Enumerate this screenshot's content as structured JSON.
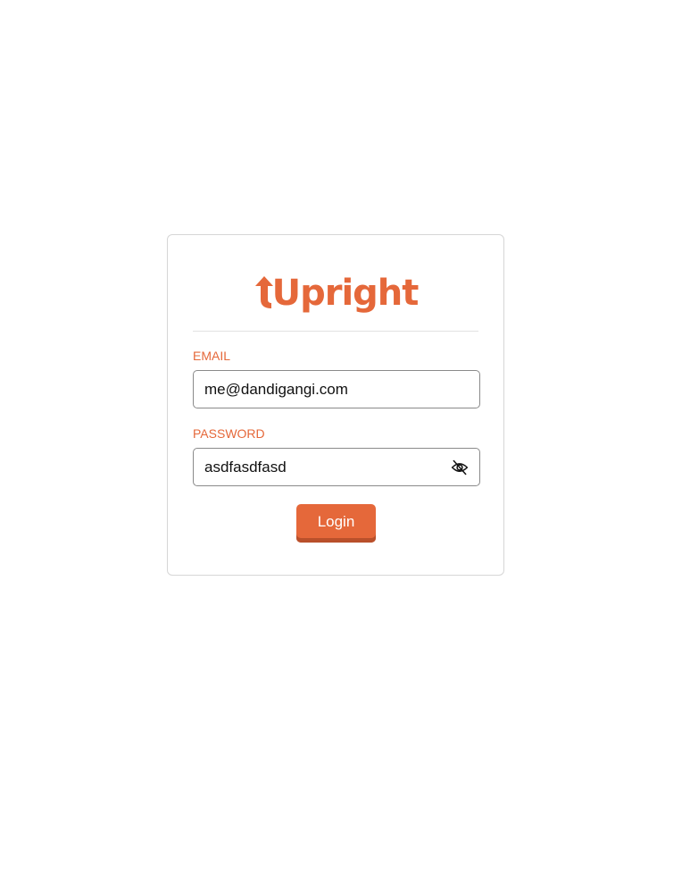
{
  "brand": {
    "name": "Upright",
    "accent": "#e5683a",
    "accent_dark": "#b9502b"
  },
  "form": {
    "email_label": "EMAIL",
    "email_value": "me@dandigangi.com",
    "password_label": "PASSWORD",
    "password_value": "asdfasdfasd",
    "password_toggle_icon": "eye-off-icon",
    "login_label": "Login"
  }
}
